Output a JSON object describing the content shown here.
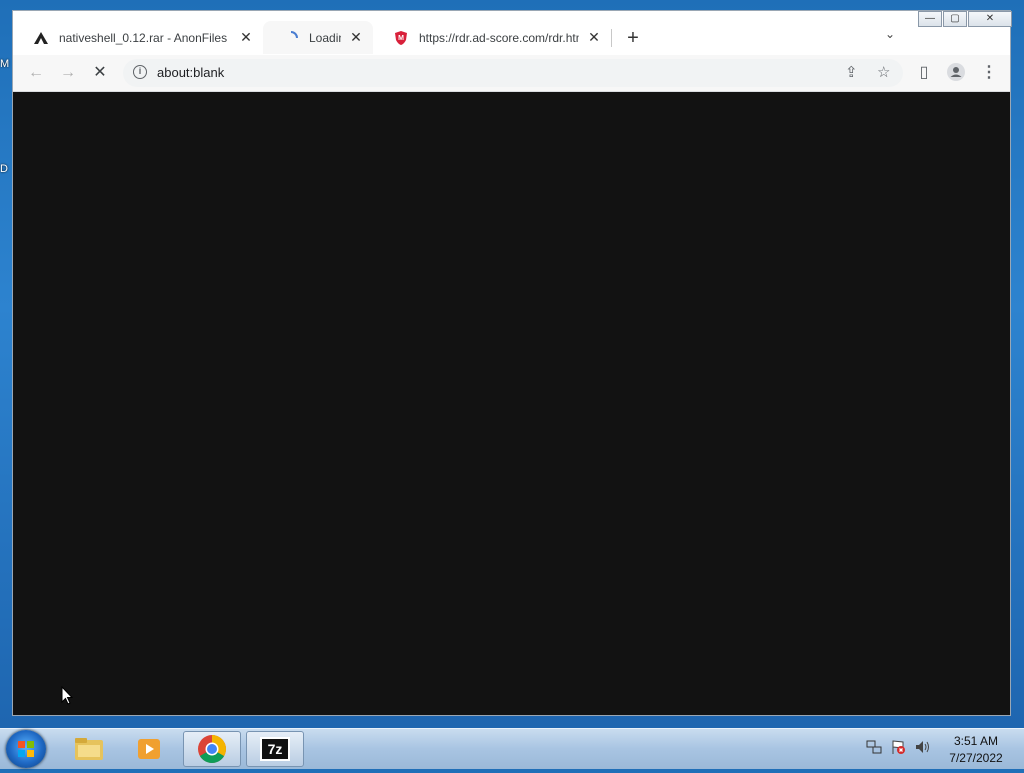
{
  "desktop": {
    "edge_letter_top": "M",
    "edge_letter_mid": "D"
  },
  "window_controls": {
    "minimize": "—",
    "maximize": "▢",
    "close": "✕"
  },
  "tabs": [
    {
      "title": "nativeshell_0.12.rar - AnonFiles",
      "icon": "anonfiles-icon",
      "close": "✕"
    },
    {
      "title": "Loading...",
      "icon": "loading-icon",
      "close": "✕",
      "active": true
    },
    {
      "title": "https://rdr.ad-score.com/rdr.html",
      "icon": "shield-icon",
      "close": "✕"
    }
  ],
  "new_tab_label": "+",
  "tab_search_label": "⌄",
  "toolbar": {
    "back": "←",
    "forward": "→",
    "stop": "✕",
    "info": "i",
    "url": "about:blank",
    "share": "⇪",
    "star": "☆",
    "sidepanel": "▯",
    "menu": "⋮"
  },
  "taskbar": {
    "apps": [
      "explorer-icon",
      "media-player-icon",
      "chrome-icon",
      "7zip-icon"
    ],
    "sevenzip_label": "7z",
    "clock_time": "3:51 AM",
    "clock_date": "7/27/2022"
  },
  "colors": {
    "page_bg": "#121212",
    "accent": "#1f6fb8"
  }
}
